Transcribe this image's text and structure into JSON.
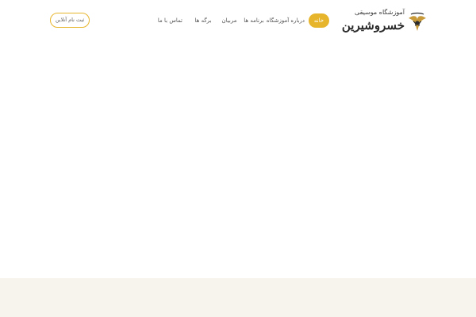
{
  "logo": {
    "small_text": "آموزشگاه موسیقی",
    "main_text": "خسروشیرین",
    "emblem_icon": "bird-emblem-icon"
  },
  "nav": {
    "home": "خانه",
    "about": "درباره آموزشگاه",
    "programs": "برنامه ها",
    "teachers": "مربیان",
    "pages": "برگه ها",
    "contact": "تماس با ما"
  },
  "register": {
    "label": "ثبت نام آنلاین"
  },
  "colors": {
    "accent": "#e7b52c",
    "footer_band": "#f7f4ee"
  }
}
